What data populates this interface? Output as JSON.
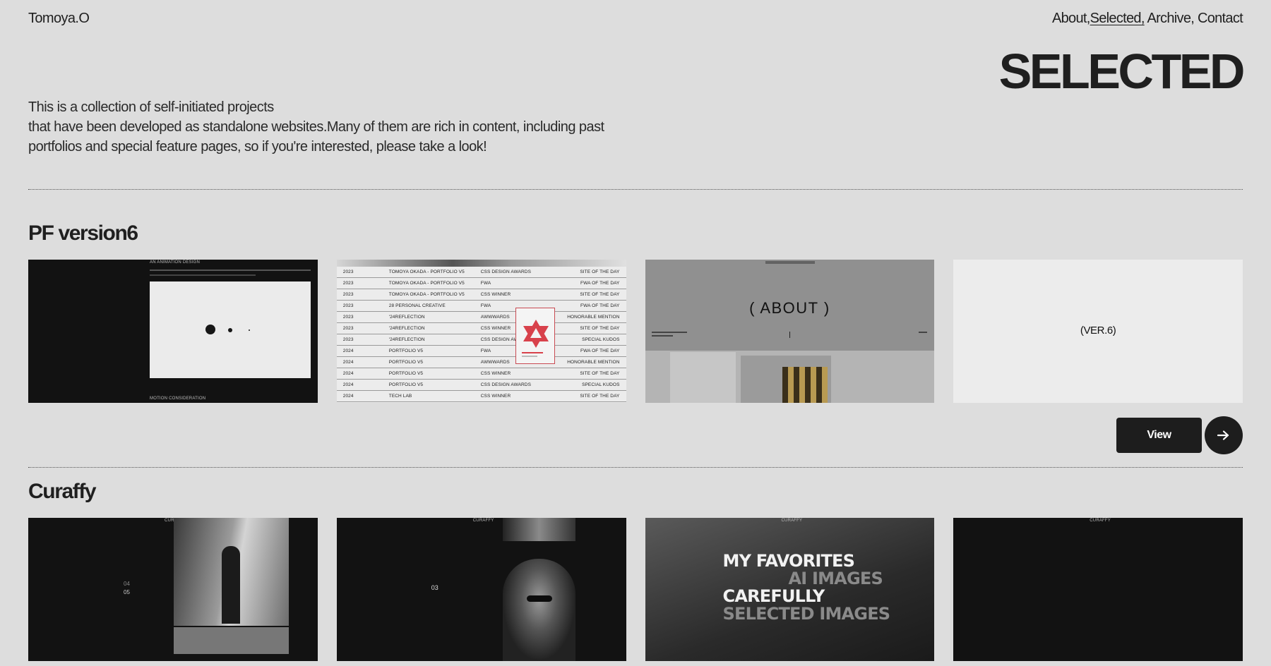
{
  "header": {
    "logo": "Tomoya.O",
    "nav": [
      {
        "label": "About,",
        "active": false
      },
      {
        "label": "Selected,",
        "active": true
      },
      {
        "label": " Archive,",
        "active": false
      },
      {
        "label": " Contact",
        "active": false
      }
    ]
  },
  "page_title": "SELECTED",
  "intro": {
    "line1": "This is a collection of self-initiated projects",
    "line2": "that have been developed as standalone websites.Many of them are rich in content, including past",
    "line3": "portfolios and special feature pages, so if you're interested, please take a look!"
  },
  "projects": [
    {
      "title": "PF version6",
      "view_label": "View",
      "thumb1": {
        "heading": "AN ANIMATION DESIGN",
        "footer": "MOTION CONSIDERATION"
      },
      "awards": [
        [
          "2023",
          "TOMOYA OKADA - PORTFOLIO V5",
          "CSS DESIGN AWARDS",
          "SITE OF THE DAY"
        ],
        [
          "2023",
          "TOMOYA OKADA - PORTFOLIO V5",
          "FWA",
          "FWA OF THE DAY"
        ],
        [
          "2023",
          "TOMOYA OKADA - PORTFOLIO V5",
          "CSS WINNER",
          "SITE OF THE DAY"
        ],
        [
          "2023",
          "28 PERSONAL CREATIVE",
          "FWA",
          "FWA OF THE DAY"
        ],
        [
          "2023",
          "'24REFLECTION",
          "AWWWARDS",
          "HONORABLE MENTION"
        ],
        [
          "2023",
          "'24REFLECTION",
          "CSS WINNER",
          "SITE OF THE DAY"
        ],
        [
          "2023",
          "'24REFLECTION",
          "CSS DESIGN AWARDS",
          "SPECIAL KUDOS"
        ],
        [
          "2024",
          "PORTFOLIO V5",
          "FWA",
          "FWA OF THE DAY"
        ],
        [
          "2024",
          "PORTFOLIO V5",
          "AWWWARDS",
          "HONORABLE MENTION"
        ],
        [
          "2024",
          "PORTFOLIO V5",
          "CSS WINNER",
          "SITE OF THE DAY"
        ],
        [
          "2024",
          "PORTFOLIO V5",
          "CSS DESIGN AWARDS",
          "SPECIAL KUDOS"
        ],
        [
          "2024",
          "TECH LAB",
          "CSS WINNER",
          "SITE OF THE DAY"
        ]
      ],
      "thumb3": {
        "label": "( ABOUT )"
      },
      "thumb4": {
        "label": "(VER.6)"
      }
    },
    {
      "title": "Curaffy",
      "thumb_brand": "CURAFFY",
      "thumb1_numbers": {
        "a": "04",
        "b": "05"
      },
      "thumb2_number": "03",
      "thumb3_words": {
        "line1": "MY FAVORITES",
        "line2": "AI IMAGES",
        "line3": "CAREFULLY",
        "line4": "SELECTED IMAGES"
      }
    }
  ],
  "colors": {
    "background": "#dddddd",
    "text": "#1f1f1f",
    "dark_thumb": "#121212",
    "button": "#1d1d1d",
    "accent_red": "#d8414b"
  }
}
